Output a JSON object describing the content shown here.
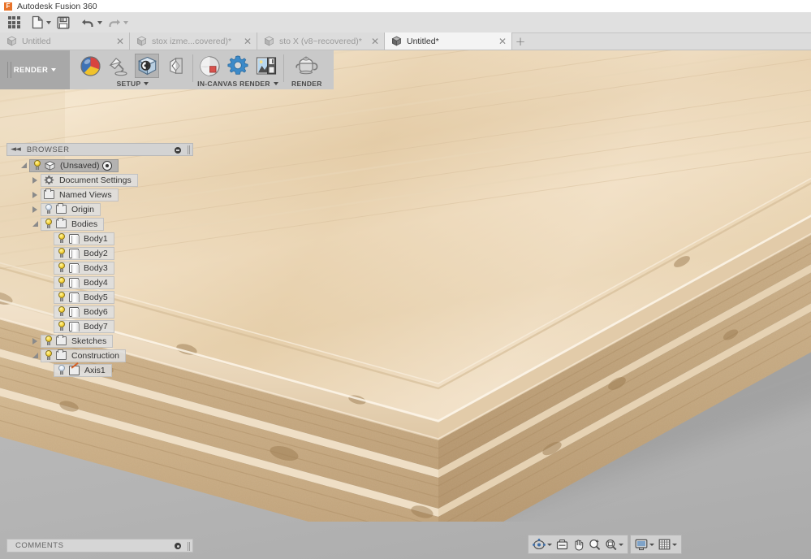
{
  "window": {
    "title": "Autodesk Fusion 360",
    "logo_letter": "F",
    "logo_color": "#e8732a"
  },
  "quick_access": {
    "items": [
      {
        "name": "app-grid",
        "icon": "grid-icon",
        "has_caret": false
      },
      {
        "name": "new-document",
        "icon": "file-icon",
        "has_caret": true
      },
      {
        "name": "save",
        "icon": "save-icon",
        "has_caret": false
      },
      {
        "name": "undo",
        "icon": "undo-arrow-icon",
        "has_caret": true
      },
      {
        "name": "redo",
        "icon": "redo-arrow-icon",
        "has_caret": true
      }
    ]
  },
  "tabs": {
    "items": [
      {
        "label": "Untitled",
        "active": false,
        "closable": true
      },
      {
        "label": "stox izme...covered)*",
        "active": false,
        "closable": true
      },
      {
        "label": "sto X (v8~recovered)*",
        "active": false,
        "closable": true
      },
      {
        "label": "Untitled*",
        "active": true,
        "closable": true
      }
    ],
    "add_label": "+"
  },
  "ribbon": {
    "workspace": {
      "label": "RENDER",
      "has_caret": true
    },
    "panels": [
      {
        "title": "SETUP",
        "has_caret": true,
        "buttons": [
          {
            "name": "appearance-button",
            "icon": "appearance-sphere-icon",
            "active": false
          },
          {
            "name": "scene-settings-button",
            "icon": "desk-lamp-icon",
            "active": false
          },
          {
            "name": "texture-map-controls-button",
            "icon": "texture-cube-icon",
            "active": true
          },
          {
            "name": "decal-button",
            "icon": "decal-icon",
            "active": false
          }
        ]
      },
      {
        "title": "IN-CANVAS RENDER",
        "has_caret": true,
        "buttons": [
          {
            "name": "in-canvas-render-button",
            "icon": "render-sphere-icon",
            "active": false
          },
          {
            "name": "in-canvas-render-settings-button",
            "icon": "gear-icon",
            "active": false
          },
          {
            "name": "capture-image-button",
            "icon": "capture-image-icon",
            "active": false
          }
        ]
      },
      {
        "title": "RENDER",
        "has_caret": false,
        "buttons": [
          {
            "name": "render-button",
            "icon": "teapot-icon",
            "active": false
          }
        ]
      }
    ]
  },
  "browser": {
    "header": {
      "title": "BROWSER",
      "collapse_icon": "collapse-left-icon",
      "options_icon": "minus-circle-icon"
    },
    "tree": [
      {
        "label": "(Unsaved)",
        "depth": 0,
        "twisty": "open",
        "icon": "component-icon",
        "bulb": "on",
        "selected": true,
        "trailing_icon": "activate-target-icon"
      },
      {
        "label": "Document Settings",
        "depth": 1,
        "twisty": "closed",
        "icon": "gear-icon",
        "bulb": "none",
        "selected": false,
        "trailing_icon": ""
      },
      {
        "label": "Named Views",
        "depth": 1,
        "twisty": "closed",
        "icon": "folder-icon",
        "bulb": "none",
        "selected": false,
        "trailing_icon": ""
      },
      {
        "label": "Origin",
        "depth": 1,
        "twisty": "closed",
        "icon": "folder-icon",
        "bulb": "off",
        "selected": false,
        "trailing_icon": ""
      },
      {
        "label": "Bodies",
        "depth": 1,
        "twisty": "open",
        "icon": "folder-icon",
        "bulb": "on",
        "selected": false,
        "trailing_icon": ""
      },
      {
        "label": "Body1",
        "depth": 2,
        "twisty": "none",
        "icon": "body-icon",
        "bulb": "on",
        "selected": false,
        "trailing_icon": ""
      },
      {
        "label": "Body2",
        "depth": 2,
        "twisty": "none",
        "icon": "body-icon",
        "bulb": "on",
        "selected": false,
        "trailing_icon": ""
      },
      {
        "label": "Body3",
        "depth": 2,
        "twisty": "none",
        "icon": "body-icon",
        "bulb": "on",
        "selected": false,
        "trailing_icon": ""
      },
      {
        "label": "Body4",
        "depth": 2,
        "twisty": "none",
        "icon": "body-icon",
        "bulb": "on",
        "selected": false,
        "trailing_icon": ""
      },
      {
        "label": "Body5",
        "depth": 2,
        "twisty": "none",
        "icon": "body-icon",
        "bulb": "on",
        "selected": false,
        "trailing_icon": ""
      },
      {
        "label": "Body6",
        "depth": 2,
        "twisty": "none",
        "icon": "body-icon",
        "bulb": "on",
        "selected": false,
        "trailing_icon": ""
      },
      {
        "label": "Body7",
        "depth": 2,
        "twisty": "none",
        "icon": "body-icon",
        "bulb": "on",
        "selected": false,
        "trailing_icon": ""
      },
      {
        "label": "Sketches",
        "depth": 1,
        "twisty": "closed",
        "icon": "folder-icon",
        "bulb": "on",
        "selected": false,
        "trailing_icon": ""
      },
      {
        "label": "Construction",
        "depth": 1,
        "twisty": "open",
        "icon": "folder-icon",
        "bulb": "on",
        "selected": false,
        "trailing_icon": ""
      },
      {
        "label": "Axis1",
        "depth": 2,
        "twisty": "none",
        "icon": "axis-icon",
        "bulb": "off",
        "selected": false,
        "trailing_icon": ""
      }
    ]
  },
  "comments": {
    "label": "COMMENTS",
    "options_icon": "circle-dot-icon"
  },
  "navigation_bar": {
    "groups": [
      {
        "buttons": [
          {
            "name": "orbit-button",
            "icon": "orbit-icon",
            "has_caret": true
          },
          {
            "name": "look-at-button",
            "icon": "look-at-icon",
            "has_caret": false
          },
          {
            "name": "pan-button",
            "icon": "pan-hand-icon",
            "has_caret": false
          },
          {
            "name": "zoom-button",
            "icon": "zoom-in-icon",
            "has_caret": false
          },
          {
            "name": "zoom-window-button",
            "icon": "magnifier-icon",
            "has_caret": true
          }
        ]
      },
      {
        "buttons": [
          {
            "name": "display-settings-button",
            "icon": "monitor-icon",
            "has_caret": true
          },
          {
            "name": "grid-snaps-button",
            "icon": "grid-icon",
            "has_caret": true
          }
        ]
      }
    ]
  },
  "viewport": {
    "name": "3d-render-viewport",
    "scene_description": "Stacked laminated wooden boards, corner view",
    "background_color": "#b5b5b5",
    "wood_light": "#f0dcc0",
    "wood_mid": "#dcc29c",
    "wood_dark": "#c2a477"
  }
}
